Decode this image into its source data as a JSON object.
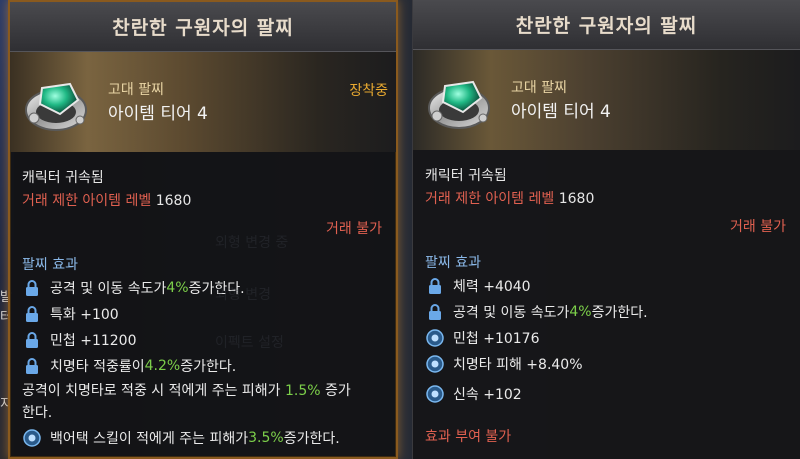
{
  "left": {
    "title": "찬란한 구원자의 팔찌",
    "grade": "고대 팔찌",
    "tier": "아이템 티어 4",
    "equipped": "장착중",
    "bound": "캐릭터 귀속됨",
    "trade_level_label": "거래 제한 아이템 레벨",
    "trade_level_value": "1680",
    "trade_status": "거래 불가",
    "effects_title": "팔찌 효과",
    "effects": [
      {
        "pre": "공격 및 이동 속도가 ",
        "hl": "4%",
        "post": " 증가한다.",
        "icon": "lock-icon"
      },
      {
        "pre": "특화 +100",
        "hl": "",
        "post": "",
        "icon": "lock-icon"
      },
      {
        "pre": "민첩 +11200",
        "hl": "",
        "post": "",
        "icon": "lock-icon"
      },
      {
        "pre": "치명타 적중률이 ",
        "hl": "4.2%",
        "post": " 증가한다.",
        "icon": "lock-icon"
      }
    ],
    "crit_text_pre": "공격이 치명타로 적중 시 적에게 주는 피해가 ",
    "crit_text_hl": "1.5%",
    "crit_text_post": " 증가",
    "crit_text_line2": "한다.",
    "back_attack": {
      "pre": "백어택 스킬이 적에게 주는 피해가 ",
      "hl": "3.5%",
      "post": " 증가한다.",
      "icon": "gear-icon"
    }
  },
  "right": {
    "title": "찬란한 구원자의 팔찌",
    "grade": "고대 팔찌",
    "tier": "아이템 티어 4",
    "bound": "캐릭터 귀속됨",
    "trade_level_label": "거래 제한 아이템 레벨",
    "trade_level_value": "1680",
    "trade_status": "거래 불가",
    "effects_title": "팔찌 효과",
    "effects": [
      {
        "pre": "체력 +4040",
        "hl": "",
        "post": "",
        "icon": "lock-icon"
      },
      {
        "pre": "공격 및 이동 속도가 ",
        "hl": "4%",
        "post": " 증가한다.",
        "icon": "lock-icon"
      },
      {
        "pre": "민첩 +10176",
        "hl": "",
        "post": "",
        "icon": "gear-icon"
      },
      {
        "pre": "치명타 피해 +8.40%",
        "hl": "",
        "post": "",
        "icon": "gear-icon"
      },
      {
        "pre": "신속 +102",
        "hl": "",
        "post": "",
        "icon": "gear-icon"
      }
    ],
    "no_effect_note": "효과 부여 불가"
  },
  "background": {
    "side_labels": [
      "발",
      "터",
      "지"
    ],
    "menu_items": [
      "외형 변경 중",
      "외형 변경",
      "이펙트 설정"
    ]
  }
}
